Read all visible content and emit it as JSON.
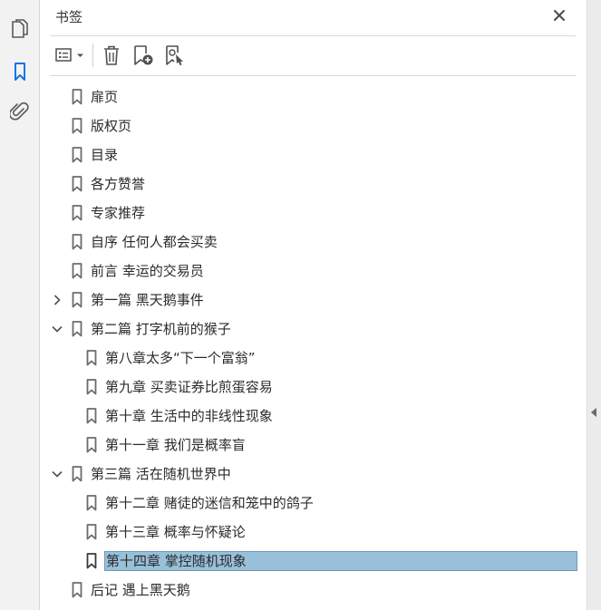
{
  "panel": {
    "title": "书签"
  },
  "rail": {
    "items": [
      {
        "name": "pages-icon"
      },
      {
        "name": "bookmark-icon",
        "active": true
      },
      {
        "name": "attachment-icon"
      }
    ]
  },
  "toolbar": {
    "buttons": [
      "options-menu-icon",
      "delete-bookmark-icon",
      "new-bookmark-icon",
      "expand-bookmark-icon"
    ]
  },
  "bookmarks": [
    {
      "label": "扉页"
    },
    {
      "label": "版权页"
    },
    {
      "label": "目录"
    },
    {
      "label": "各方赞誉"
    },
    {
      "label": "专家推荐"
    },
    {
      "label": "自序 任何人都会买卖"
    },
    {
      "label": "前言 幸运的交易员"
    },
    {
      "label": "第一篇 黑天鹅事件",
      "state": "collapsed"
    },
    {
      "label": "第二篇 打字机前的猴子",
      "state": "expanded"
    },
    {
      "label": "第八章太多“下一个富翁”"
    },
    {
      "label": "第九章 买卖证券比煎蛋容易"
    },
    {
      "label": "第十章 生活中的非线性现象"
    },
    {
      "label": "第十一章 我们是概率盲"
    },
    {
      "label": "第三篇 活在随机世界中",
      "state": "expanded"
    },
    {
      "label": "第十二章 赌徒的迷信和笼中的鸽子"
    },
    {
      "label": "第十三章 概率与怀疑论"
    },
    {
      "label": "第十四章 掌控随机现象",
      "selected": true
    },
    {
      "label": "后记 遇上黑天鹅"
    }
  ],
  "colors": {
    "accent": "#1473e6",
    "selection": "#98c0d9",
    "icon": "#505050"
  }
}
